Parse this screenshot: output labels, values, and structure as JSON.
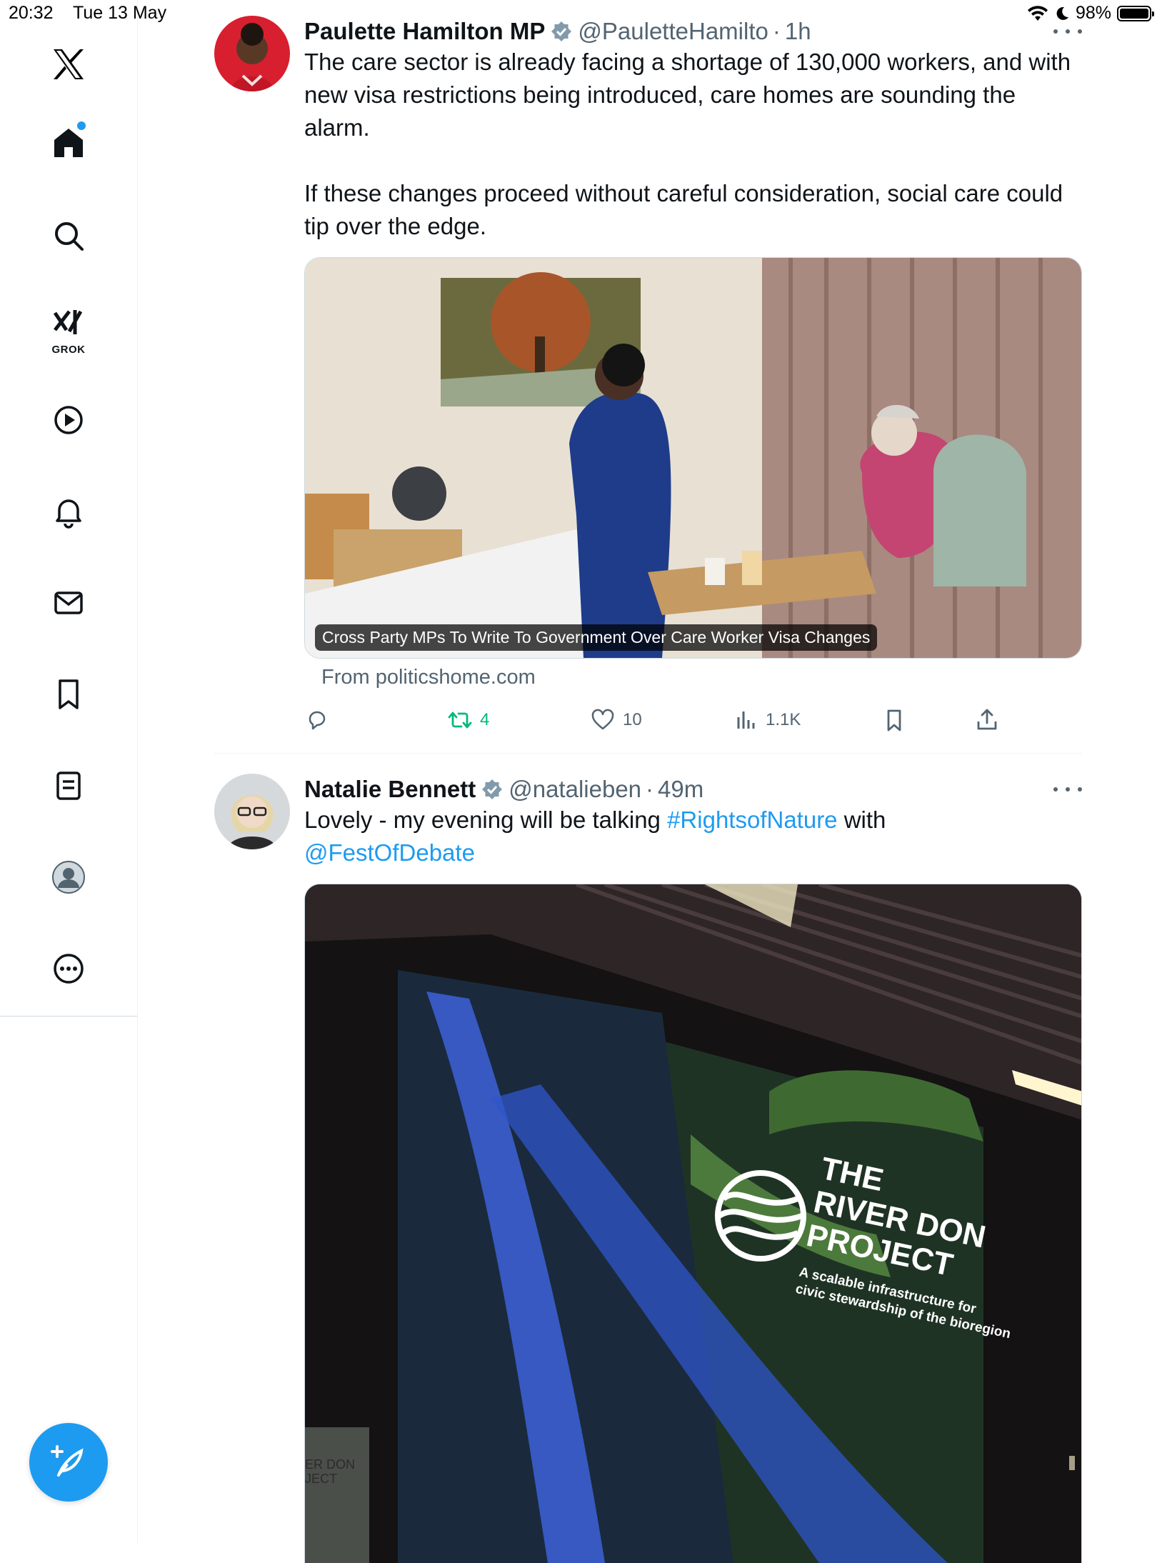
{
  "status_bar": {
    "time": "20:32",
    "date": "Tue 13 May",
    "battery_percent": "98%",
    "battery_level": 0.98
  },
  "sidebar": {
    "items": [
      {
        "name": "x-logo",
        "label": ""
      },
      {
        "name": "home",
        "label": "",
        "has_notification_dot": true
      },
      {
        "name": "search",
        "label": ""
      },
      {
        "name": "grok",
        "label": "GROK"
      },
      {
        "name": "videos",
        "label": ""
      },
      {
        "name": "notifications",
        "label": ""
      },
      {
        "name": "messages",
        "label": ""
      },
      {
        "name": "bookmarks",
        "label": ""
      },
      {
        "name": "lists",
        "label": ""
      },
      {
        "name": "profile",
        "label": ""
      },
      {
        "name": "more",
        "label": ""
      }
    ],
    "compose_icon": "feather-plus-icon"
  },
  "colors": {
    "accent": "#1d9bf0",
    "retweet_green": "#00ba7c",
    "secondary_text": "#536471"
  },
  "tweets": [
    {
      "display_name": "Paulette Hamilton MP",
      "handle": "@PauletteHamilto",
      "separator": "·",
      "time_ago": "1h",
      "verified": true,
      "text": "The care sector is already facing a shortage of 130,000 workers, and with new visa restrictions being introduced, care homes are sounding the alarm.\n\nIf these changes proceed without careful consideration, social care could tip over the edge.",
      "card": {
        "caption": "Cross Party MPs To Write To Government Over Care Worker Visa Changes",
        "source": "From politicshome.com"
      },
      "actions": {
        "replies": "",
        "retweets": "4",
        "likes": "10",
        "views": "1.1K"
      }
    },
    {
      "display_name": "Natalie Bennett",
      "handle": "@natalieben",
      "separator": "·",
      "time_ago": "49m",
      "verified": true,
      "text_before": "Lovely - my evening will be talking ",
      "hashtag": "#RightsofNature",
      "text_middle": " with",
      "mention": "@FestOfDebate",
      "image": {
        "sign_title_line1": "THE",
        "sign_title_line2": "RIVER DON",
        "sign_title_line3": "PROJECT",
        "sign_subtitle_line1": "A scalable infrastructure for",
        "sign_subtitle_line2": "civic stewardship of the bioregion",
        "side_banner_line1": "ER DON",
        "side_banner_line2": "JECT"
      }
    }
  ]
}
